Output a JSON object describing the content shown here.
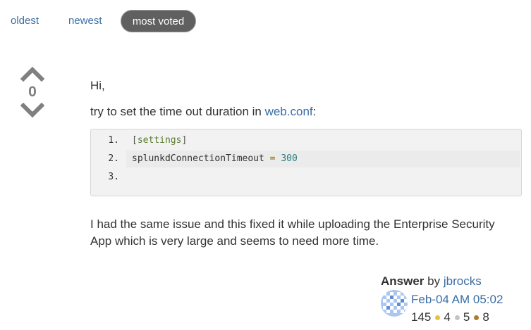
{
  "tabs": [
    {
      "label": "oldest"
    },
    {
      "label": "newest"
    },
    {
      "label": "most voted"
    }
  ],
  "vote": {
    "count": "0"
  },
  "post": {
    "greeting": "Hi,",
    "intro_before": "try to set the time out duration in ",
    "intro_link": "web.conf",
    "intro_after": ":",
    "code": {
      "line_numbers": [
        "1.",
        "2.",
        "3."
      ],
      "bracket_open": "[",
      "section": "settings",
      "bracket_close": "]",
      "key": "splunkdConnectionTimeout",
      "operator": "=",
      "value": "300"
    },
    "closing": "I had the same issue and this fixed it while uploading the Enterprise Security App which is very large and seems to need more time."
  },
  "answer": {
    "label": "Answer",
    "by": "by",
    "author": "jbrocks",
    "date": "Feb-04 AM 05:02",
    "reputation": "145",
    "gold": "4",
    "silver": "5",
    "bronze": "8"
  },
  "colors": {
    "gold": "#e6c33b",
    "silver": "#c4c4c4",
    "bronze": "#b07a2a",
    "link": "#3a6ea5"
  }
}
